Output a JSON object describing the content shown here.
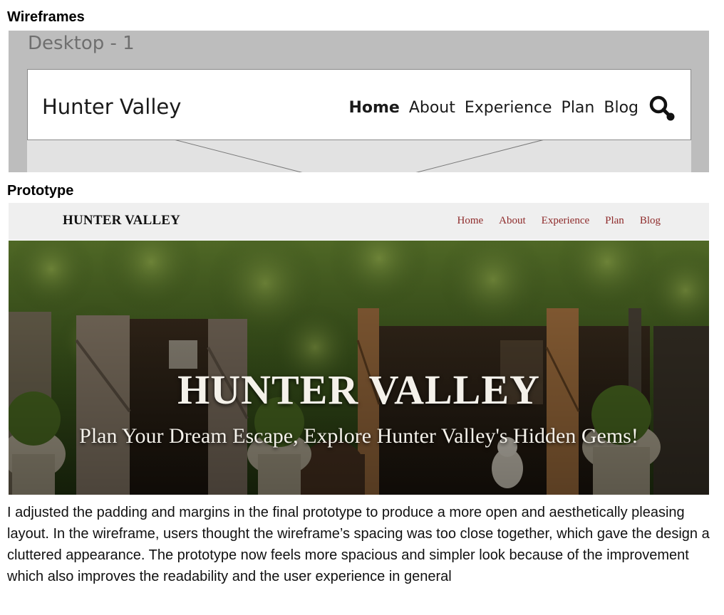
{
  "wireframes": {
    "heading": "Wireframes",
    "frame_label": "Desktop - 1",
    "brand": "Hunter Valley",
    "nav_items": [
      "Home",
      "About",
      "Experience",
      "Plan",
      "Blog"
    ],
    "active_item": "Home",
    "search_icon": "search-icon"
  },
  "prototype": {
    "heading": "Prototype",
    "brand": "HUNTER VALLEY",
    "nav_items": [
      "Home",
      "About",
      "Experience",
      "Plan",
      "Blog"
    ],
    "nav_color": "#8e2a2a",
    "hero": {
      "title": "HUNTER VALLEY",
      "subtitle": "Plan Your Dream Escape, Explore Hunter Valley's Hidden Gems!"
    }
  },
  "description": "I adjusted the padding and margins in the final prototype to produce a more open and aesthetically pleasing layout. In the wireframe, users thought the wireframe’s spacing was too close together, which gave the design a cluttered appearance. The prototype now feels more spacious and simpler look because of the improvement which also improves the readability and the user experience in general"
}
